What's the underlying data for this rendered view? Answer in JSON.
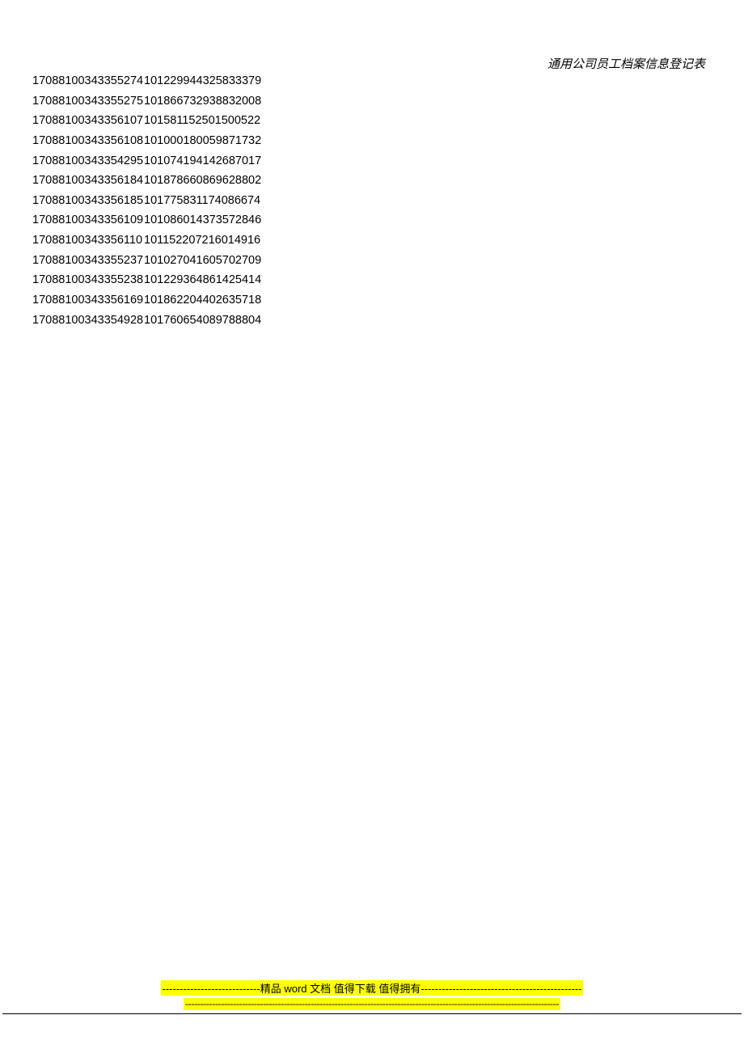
{
  "header": {
    "title": "通用公司员工档案信息登记表"
  },
  "rows": [
    {
      "c1": "17088100343355274",
      "c2": "101229944325833379"
    },
    {
      "c1": "17088100343355275",
      "c2": "101866732938832008"
    },
    {
      "c1": "17088100343356107",
      "c2": "101581152501500522"
    },
    {
      "c1": "17088100343356108",
      "c2": "101000180059871732"
    },
    {
      "c1": "17088100343354295",
      "c2": "101074194142687017"
    },
    {
      "c1": "17088100343356184",
      "c2": "101878660869628802"
    },
    {
      "c1": "17088100343356185",
      "c2": "101775831174086674"
    },
    {
      "c1": "17088100343356109",
      "c2": "101086014373572846"
    },
    {
      "c1": "17088100343356110",
      "c2": "101152207216014916"
    },
    {
      "c1": "17088100343355237",
      "c2": "101027041605702709"
    },
    {
      "c1": "17088100343355238",
      "c2": "101229364861425414"
    },
    {
      "c1": "17088100343356169",
      "c2": "101862204402635718"
    },
    {
      "c1": "17088100343354928",
      "c2": "101760654089788804"
    }
  ],
  "footer": {
    "line1_prefix": "----------------------------",
    "line1_text": "精品 word 文档  值得下载  值得拥有",
    "line1_suffix": "----------------------------------------------",
    "line2": "-----------------------------------------------------------------------------------------------------------------------------"
  }
}
